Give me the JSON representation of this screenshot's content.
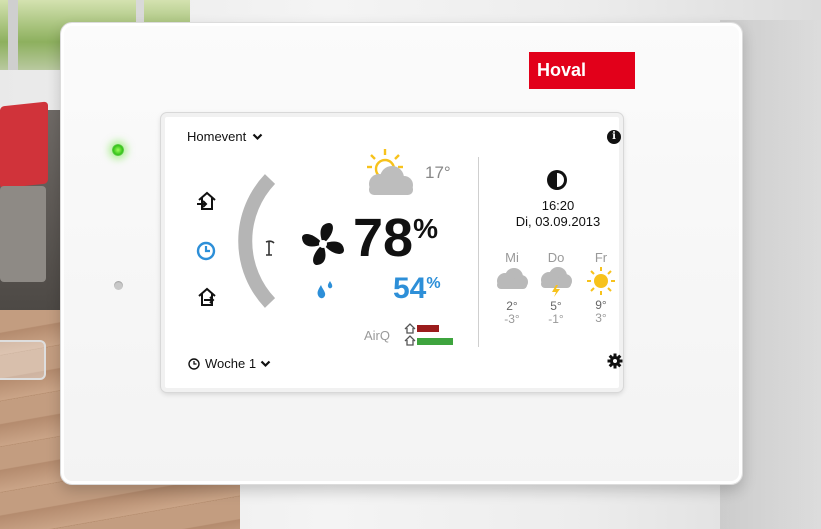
{
  "brand": {
    "logo_text": "Hoval",
    "color": "#e2001a"
  },
  "screen": {
    "mode_label": "Homevent",
    "week_label": "Woche 1",
    "outdoor_temp": "17°",
    "humidity_main": "78",
    "humidity_main_unit": "%",
    "humidity_second": "54",
    "humidity_second_unit": "%",
    "airq_label": "AirQ",
    "time": "16:20",
    "date": "Di, 03.09.2013",
    "forecast": [
      {
        "day": "Mi",
        "icon": "cloud-icon",
        "high": "2°",
        "low": "-3°"
      },
      {
        "day": "Do",
        "icon": "thunderstorm-icon",
        "high": "5°",
        "low": "-1°"
      },
      {
        "day": "Fr",
        "icon": "sun-icon",
        "high": "9°",
        "low": "3°"
      }
    ],
    "colors": {
      "accent_blue": "#2d8fd8",
      "airq_bad": "#9b1c1c",
      "airq_good": "#3ea43e",
      "sun": "#f7c21b"
    }
  }
}
